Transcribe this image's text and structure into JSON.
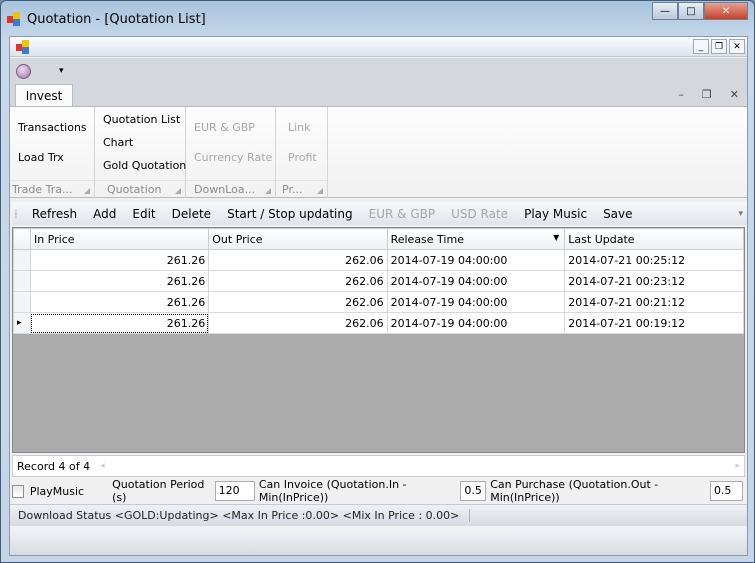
{
  "window": {
    "title": "Quotation - [Quotation List]",
    "minimize": "—",
    "maximize": "□",
    "close": "✕"
  },
  "mdi": {
    "minimize": "_",
    "restore": "❐",
    "close": "✕"
  },
  "ribbon": {
    "tab": "Invest",
    "tab_controls": [
      "–",
      "❐",
      "✕"
    ],
    "groups": [
      {
        "caption": "Trade Tra...",
        "items": [
          "Transactions",
          "Load Trx"
        ]
      },
      {
        "caption": "Quotation",
        "items": [
          "Quotation List",
          "Chart",
          "Gold Quotation"
        ]
      },
      {
        "caption": "DownLoa...",
        "items": [
          "EUR & GBP",
          "Currency Rate"
        ]
      },
      {
        "caption": "Pr...",
        "items": [
          "Link",
          "Profit"
        ]
      }
    ]
  },
  "toolbar": {
    "items": [
      "Refresh",
      "Add",
      "Edit",
      "Delete",
      "Start / Stop updating",
      "EUR & GBP",
      "USD Rate",
      "Play Music",
      "Save"
    ],
    "overflow": "▾"
  },
  "grid": {
    "columns": [
      "In Price",
      "Out Price",
      "Release Time",
      "Last Update"
    ],
    "rows": [
      [
        "261.26",
        "262.06",
        "2014-07-19 04:00:00",
        "2014-07-21 00:25:12"
      ],
      [
        "261.26",
        "262.06",
        "2014-07-19 04:00:00",
        "2014-07-21 00:23:12"
      ],
      [
        "261.26",
        "262.06",
        "2014-07-19 04:00:00",
        "2014-07-21 00:21:12"
      ],
      [
        "261.26",
        "262.06",
        "2014-07-19 04:00:00",
        "2014-07-21 00:19:12"
      ]
    ],
    "current_row_marker": "▸",
    "record": "Record 4 of 4"
  },
  "options": {
    "play_music": "PlayMusic",
    "period_label": "Quotation Period (s)",
    "period": "120",
    "invoice_label": "Can Invoice (Quotation.In - Min(InPrice))",
    "invoice": "0.5",
    "purchase_label": "Can Purchase (Quotation.Out - Min(InPrice))",
    "purchase": "0.5"
  },
  "status": "Download Status <GOLD:Updating>  <Max In Price :0.00> <Mix In Price : 0.00>"
}
